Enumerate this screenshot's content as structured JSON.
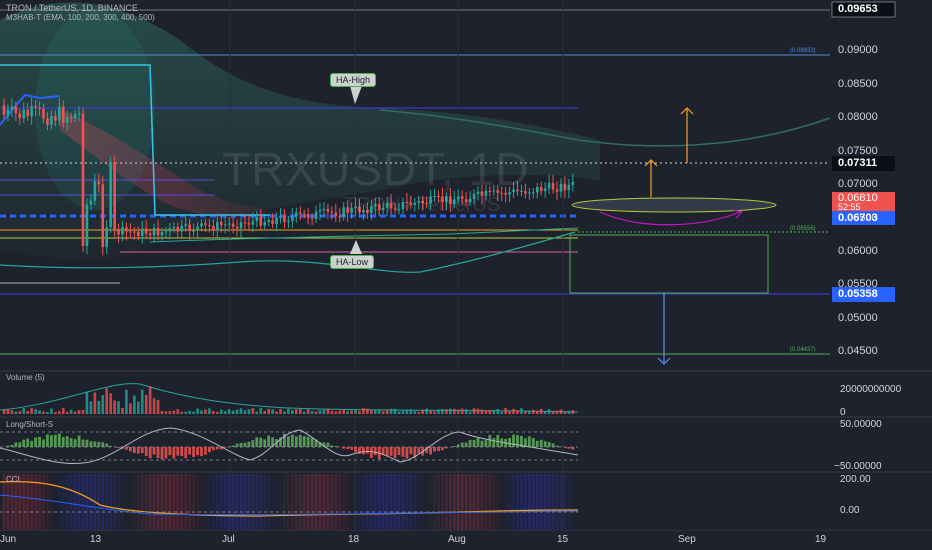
{
  "header": {
    "symbol_line": "TRON / TetherUS, 1D, BINANCE",
    "indicator_line": "M3HAB-T (EMA, 100, 200, 300, 400, 500)"
  },
  "watermark": {
    "symbol": "TRXUSDT, 1D",
    "name": "TRON / TetherUS"
  },
  "annotations": {
    "ha_high": "HA-High",
    "ha_low": "HA-Low",
    "fib_labels": [
      "(0.08933)",
      "(0.06556)",
      "(0.04437)"
    ]
  },
  "price_axis": {
    "ticks": [
      "0.09000",
      "0.08500",
      "0.08000",
      "0.07500",
      "0.07000",
      "0.06500",
      "0.06000",
      "0.05500",
      "0.05000",
      "0.04500"
    ],
    "tag_top": "0.09653",
    "tag_level_1": "0.07311",
    "tag_last": "0.06810",
    "tag_countdown": "52:55",
    "tag_level_2": "0.06703",
    "tag_level_3": "0.05358"
  },
  "volume_pane": {
    "label": "Volume (5)",
    "ticks": [
      "20000000000",
      "0"
    ]
  },
  "longshort_pane": {
    "label": "Long/Short-S",
    "ticks": [
      "50.00000",
      "−50.00000"
    ]
  },
  "cci_pane": {
    "label": "CCI",
    "ticks": [
      "200.00",
      "0.00"
    ]
  },
  "time_axis": {
    "labels": [
      "Jun",
      "13",
      "Jul",
      "18",
      "Aug",
      "15",
      "Sep",
      "19"
    ]
  },
  "colors": {
    "bull": "#26a69a",
    "bear": "#ef5350",
    "blue_tag": "#2962ff",
    "orange": "#f7a21b",
    "green_box": "#4caf50",
    "magenta": "#c218c2"
  },
  "chart_data": {
    "type": "candlestick",
    "title": "TRON / TetherUS, 1D, BINANCE",
    "x": [
      "Jun",
      "13",
      "Jul",
      "18",
      "Aug",
      "15",
      "Sep",
      "19"
    ],
    "ylim": [
      0.0425,
      0.0975
    ],
    "levels": [
      {
        "label": "(0.08933)",
        "value": 0.08933
      },
      {
        "label": "0.07311",
        "value": 0.07311
      },
      {
        "label": "0.06703",
        "value": 0.06703
      },
      {
        "label": "(0.06556)",
        "value": 0.06556
      },
      {
        "label": "0.05358",
        "value": 0.05358
      },
      {
        "label": "(0.04437)",
        "value": 0.04437
      }
    ],
    "last_price": 0.0681
  }
}
